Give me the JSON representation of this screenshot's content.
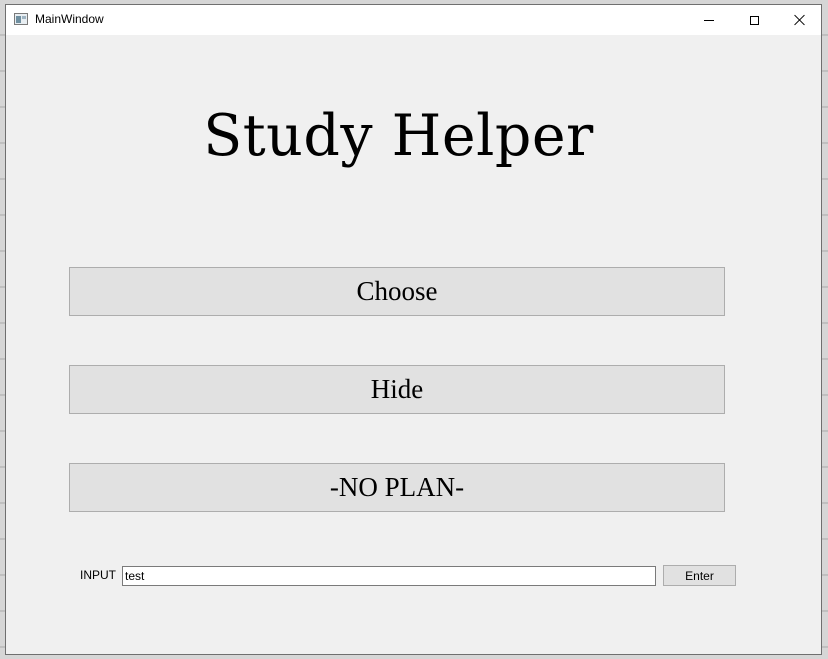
{
  "window": {
    "title": "MainWindow",
    "controls": {
      "minimize_icon": "minimize-icon",
      "maximize_icon": "maximize-icon",
      "close_icon": "close-icon"
    }
  },
  "main": {
    "heading": "Study Helper",
    "buttons": {
      "choose": "Choose",
      "hide": "Hide",
      "plan": "-NO PLAN-"
    }
  },
  "input_row": {
    "label": "INPUT",
    "value": "test",
    "enter_label": "Enter"
  }
}
